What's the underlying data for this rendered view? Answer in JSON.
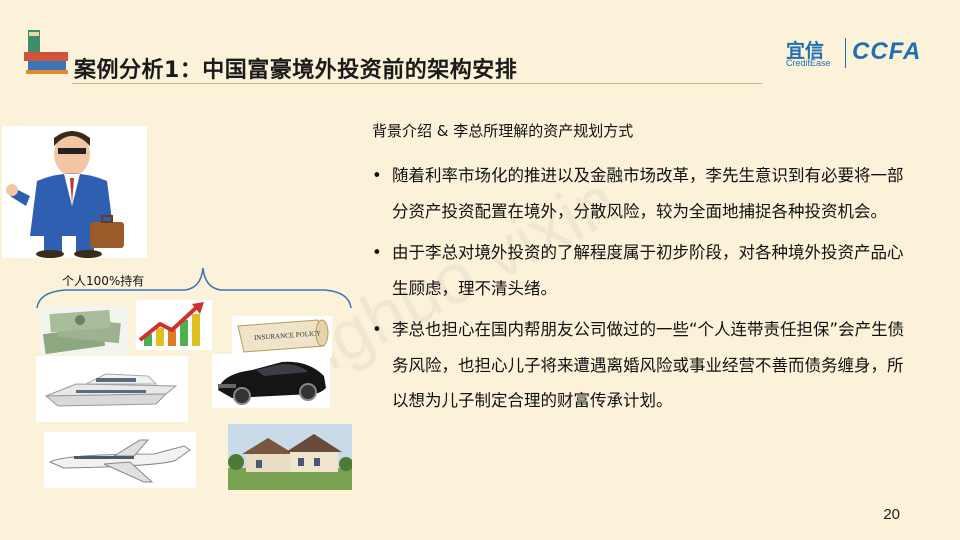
{
  "header": {
    "title": "案例分析1：中国富豪境外投资前的架构安排",
    "logo_cn": "宜信",
    "logo_en": "CreditEase",
    "logo_ccfa": "CCFA"
  },
  "left": {
    "brace_label": "个人100%持有",
    "images": [
      "businessman",
      "cash-stack",
      "growth-chart",
      "insurance-policy",
      "yacht",
      "sports-car",
      "private-jet",
      "villa"
    ],
    "insurance_text": "INSURANCE POLICY"
  },
  "content": {
    "heading": "背景介绍 & 李总所理解的资产规划方式",
    "bullet_symbol": "•",
    "bullets": [
      "随着利率市场化的推进以及金融市场改革，李先生意识到有必要将一部分资产投资配置在境外，分散风险，较为全面地捕捉各种投资机会。",
      "由于李总对境外投资的了解程度属于初步阶段，对各种境外投资产品心生顾虑，理不清头绪。",
      "李总也担心在国内帮朋友公司做过的一些“个人连带责任担保”会产生债务风险，也担心儿子将来遭遇离婚风险或事业经营不善而债务缠身，所以想为儿子制定合理的财富传承计划。"
    ]
  },
  "footer": {
    "page_number": "20"
  },
  "colors": {
    "accent_blue": "#1f6fb5",
    "background": "#fbf2d9"
  }
}
